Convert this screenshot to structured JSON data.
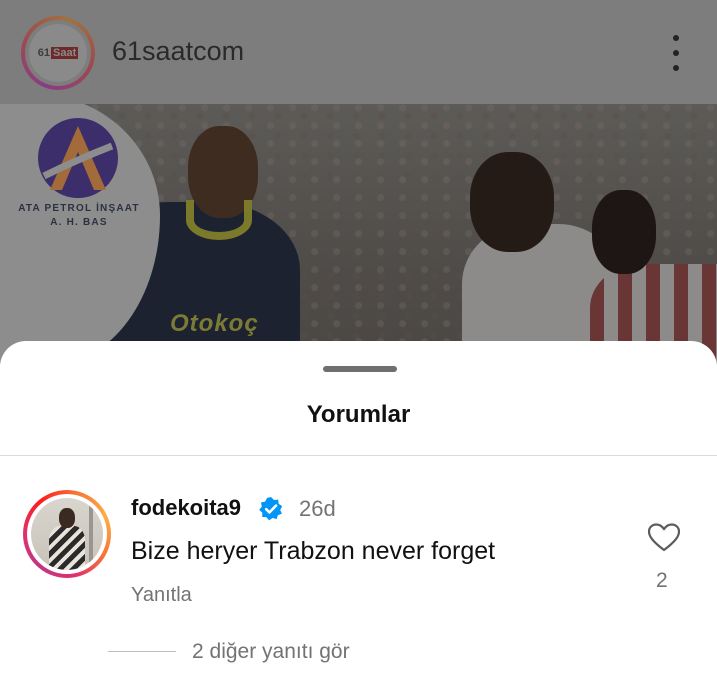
{
  "post": {
    "account_name": "61saatcom",
    "logo_text": {
      "number": "61",
      "word": "Saat"
    },
    "sponsor": {
      "line1": "ATA PETROL İNŞAAT",
      "line2": "A. H. BAS"
    },
    "shirt_sponsor": "Otokoç",
    "more_icon": "more-vertical-icon"
  },
  "sheet": {
    "title": "Yorumlar"
  },
  "comment": {
    "username": "fodekoita9",
    "verified": true,
    "time": "26d",
    "text": "Bize heryer Trabzon never forget",
    "reply_label": "Yanıtla",
    "like_count": "2",
    "view_replies": "2 diğer yanıtı gör"
  },
  "colors": {
    "verified_blue": "#0095f6",
    "secondary_text": "#737373",
    "overlay_dim": "#7d7d7d"
  }
}
